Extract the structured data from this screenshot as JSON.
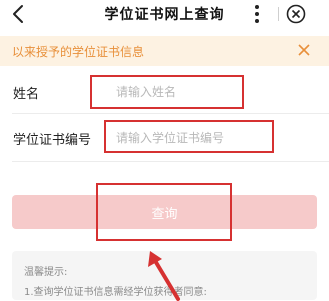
{
  "nav": {
    "title": "学位证书网上查询"
  },
  "notice": {
    "text": "以来授予的学位证书信息"
  },
  "form": {
    "name_label": "姓名",
    "name_placeholder": "请输入姓名",
    "cert_label": "学位证书编号",
    "cert_placeholder": "请输入学位证书编号",
    "submit_label": "查询"
  },
  "tips": {
    "title": "温馨提示:",
    "line1": "1.查询学位证书信息需经学位获得者同意:"
  },
  "colors": {
    "notice_bg": "#fdf2e2",
    "notice_text": "#e8903a",
    "button_bg": "#f6caca",
    "annotation_red": "#d63131"
  },
  "icons": [
    "back-arrow-icon",
    "more-dots-icon",
    "close-circle-icon",
    "notice-close-icon"
  ]
}
